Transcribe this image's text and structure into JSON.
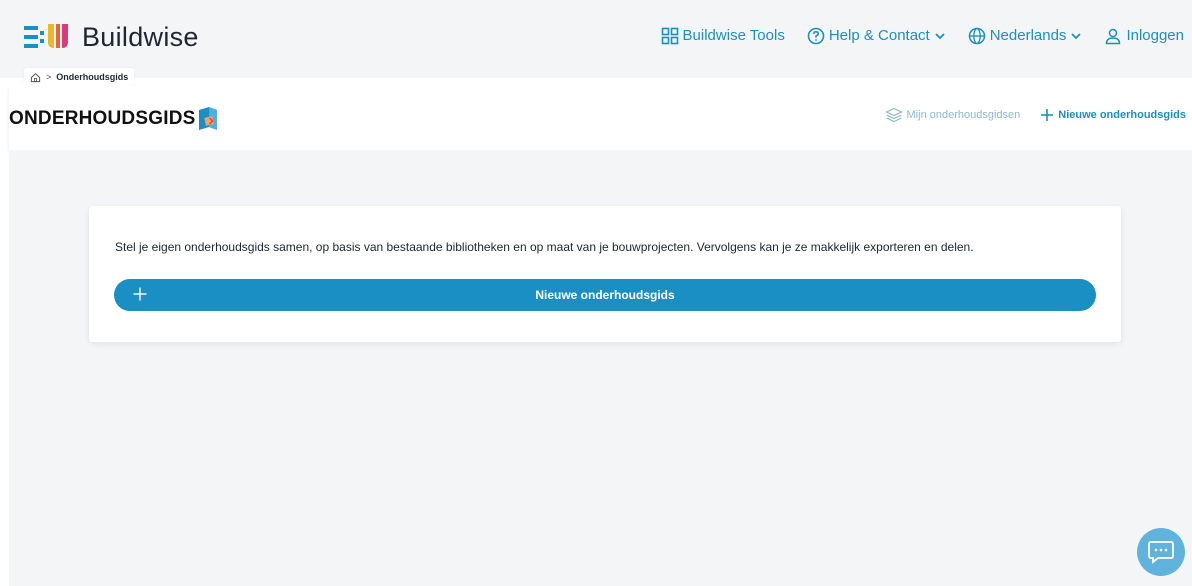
{
  "header": {
    "logo_text": "Buildwise",
    "nav": {
      "tools": "Buildwise Tools",
      "help": "Help & Contact",
      "language": "Nederlands",
      "login": "Inloggen"
    }
  },
  "breadcrumb": {
    "current": "Onderhoudsgids"
  },
  "subheader": {
    "title": "ONDERHOUDSGIDS",
    "my_guides": "Mijn onderhoudsgidsen",
    "new_guide": "Nieuwe onderhoudsgids"
  },
  "card": {
    "description": "Stel je eigen onderhoudsgids samen, op basis van bestaande bibliotheken en op maat van je bouwprojecten. Vervolgens kan je ze makkelijk exporteren en delen.",
    "button_label": "Nieuwe onderhoudsgids"
  },
  "colors": {
    "accent": "#1a8fc4",
    "background": "#f4f5f6",
    "chat_button": "#5fb3dc"
  },
  "icons": {
    "tools": "grid-icon",
    "help": "question-circle-icon",
    "language": "globe-icon",
    "login": "user-icon",
    "home": "home-icon",
    "my_guides": "layers-icon",
    "new_guide": "plus-icon",
    "chat": "chat-icon"
  }
}
